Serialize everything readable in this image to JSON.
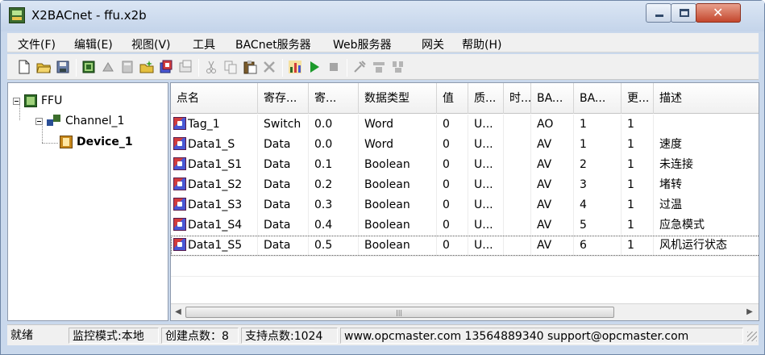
{
  "window": {
    "title": "X2BACnet - ffu.x2b"
  },
  "menu": [
    "文件(F)",
    "编辑(E)",
    "视图(V)",
    "工具",
    "BACnet服务器",
    "Web服务器",
    "网关",
    "帮助(H)"
  ],
  "toolbar": {
    "icons": [
      "new-icon",
      "open-icon",
      "save-icon",
      "add-channel-icon",
      "add-device-icon",
      "edit-device-icon",
      "add-tag-icon",
      "import-tags-icon",
      "properties-icon",
      "cut-icon",
      "copy-icon",
      "paste-icon",
      "delete-icon",
      "monitor-icon",
      "run-icon",
      "stop-icon",
      "tools-icon",
      "bacnet-icon",
      "web-icon"
    ]
  },
  "tree": {
    "root": "FFU",
    "channel": "Channel_1",
    "device": "Device_1"
  },
  "table": {
    "columns": [
      "点名",
      "寄存...",
      "寄...",
      "数据类型",
      "值",
      "质...",
      "时...",
      "BA...",
      "BA...",
      "更...",
      "描述"
    ],
    "rows": [
      [
        "Tag_1",
        "Switch",
        "0.0",
        "Word",
        "0",
        "U...",
        "",
        "AO",
        "1",
        "1",
        ""
      ],
      [
        "Data1_S",
        "Data",
        "0.0",
        "Word",
        "0",
        "U...",
        "",
        "AV",
        "1",
        "1",
        "速度"
      ],
      [
        "Data1_S1",
        "Data",
        "0.1",
        "Boolean",
        "0",
        "U...",
        "",
        "AV",
        "2",
        "1",
        "未连接"
      ],
      [
        "Data1_S2",
        "Data",
        "0.2",
        "Boolean",
        "0",
        "U...",
        "",
        "AV",
        "3",
        "1",
        "堵转"
      ],
      [
        "Data1_S3",
        "Data",
        "0.3",
        "Boolean",
        "0",
        "U...",
        "",
        "AV",
        "4",
        "1",
        "过温"
      ],
      [
        "Data1_S4",
        "Data",
        "0.4",
        "Boolean",
        "0",
        "U...",
        "",
        "AV",
        "5",
        "1",
        "应急模式"
      ],
      [
        "Data1_S5",
        "Data",
        "0.5",
        "Boolean",
        "0",
        "U...",
        "",
        "AV",
        "6",
        "1",
        "风机运行状态"
      ]
    ]
  },
  "status": {
    "ready": "就绪",
    "mode": "监控模式:本地",
    "created": "创建点数：8",
    "supported": "支持点数:1024",
    "contact": "www.opcmaster.com 13564889340 support@opcmaster.com"
  }
}
